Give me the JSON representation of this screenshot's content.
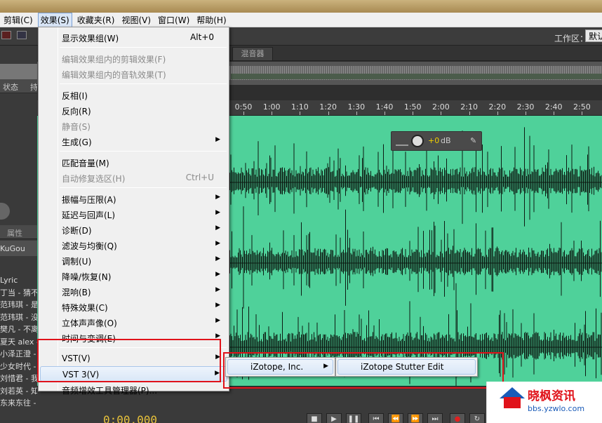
{
  "menubar": {
    "items": [
      "剪辑(C)",
      "效果(S)",
      "收藏夹(R)",
      "视图(V)",
      "窗口(W)",
      "帮助(H)"
    ],
    "active_index": 1
  },
  "toolbar": {
    "workspace_label": "工作区：",
    "workspace_value": "默认"
  },
  "left_panel": {
    "status_label": "状态",
    "col2_label": "持",
    "props_tab": "属性",
    "kugou_label": "KuGou",
    "files": [
      "Lyric",
      "丁当 - 猜不",
      "范玮琪 - 是",
      "范玮琪 - 没",
      "樊凡 - 不离",
      "夏天 alex -",
      "小泽正澄 -",
      "少女时代 -",
      "刘惜君 - 我",
      "刘若英 - 知道不知道 .mp",
      "东来东往 - ... 婚娅插曲】"
    ]
  },
  "editor": {
    "mixer_tab": "混音器",
    "ruler_ticks": [
      "0:50",
      "1:00",
      "1:10",
      "1:20",
      "1:30",
      "1:40",
      "1:50",
      "2:00",
      "2:10",
      "2:20",
      "2:30",
      "2:40",
      "2:50"
    ],
    "hud": {
      "value": "+0",
      "unit": "dB"
    },
    "waveform_color": "#4fd19a"
  },
  "transport": {
    "timecode": "0:00.000"
  },
  "effects_menu": {
    "items": [
      {
        "label": "显示效果组(W)",
        "shortcut": "Alt+0",
        "disabled": false,
        "submenu": false
      },
      {
        "sep": true
      },
      {
        "label": "编辑效果组内的剪辑效果(F)",
        "shortcut": "",
        "disabled": true,
        "submenu": false
      },
      {
        "label": "编辑效果组内的音轨效果(T)",
        "shortcut": "",
        "disabled": true,
        "submenu": false
      },
      {
        "sep": true
      },
      {
        "label": "反相(I)",
        "shortcut": "",
        "disabled": false,
        "submenu": false
      },
      {
        "label": "反向(R)",
        "shortcut": "",
        "disabled": false,
        "submenu": false
      },
      {
        "label": "静音(S)",
        "shortcut": "",
        "disabled": true,
        "submenu": false
      },
      {
        "label": "生成(G)",
        "shortcut": "",
        "disabled": false,
        "submenu": true
      },
      {
        "sep": true
      },
      {
        "label": "匹配音量(M)",
        "shortcut": "",
        "disabled": false,
        "submenu": false
      },
      {
        "label": "自动修复选区(H)",
        "shortcut": "Ctrl+U",
        "disabled": true,
        "submenu": false
      },
      {
        "sep": true
      },
      {
        "label": "振幅与压限(A)",
        "shortcut": "",
        "disabled": false,
        "submenu": true
      },
      {
        "label": "延迟与回声(L)",
        "shortcut": "",
        "disabled": false,
        "submenu": true
      },
      {
        "label": "诊断(D)",
        "shortcut": "",
        "disabled": false,
        "submenu": true
      },
      {
        "label": "滤波与均衡(Q)",
        "shortcut": "",
        "disabled": false,
        "submenu": true
      },
      {
        "label": "调制(U)",
        "shortcut": "",
        "disabled": false,
        "submenu": true
      },
      {
        "label": "降噪/恢复(N)",
        "shortcut": "",
        "disabled": false,
        "submenu": true
      },
      {
        "label": "混响(B)",
        "shortcut": "",
        "disabled": false,
        "submenu": true
      },
      {
        "label": "特殊效果(C)",
        "shortcut": "",
        "disabled": false,
        "submenu": true
      },
      {
        "label": "立体声声像(O)",
        "shortcut": "",
        "disabled": false,
        "submenu": true
      },
      {
        "label": "时间与变调(E)",
        "shortcut": "",
        "disabled": false,
        "submenu": true
      },
      {
        "sep": true
      },
      {
        "label": "VST(V)",
        "shortcut": "",
        "disabled": false,
        "submenu": true
      },
      {
        "label": "VST 3(V)",
        "shortcut": "",
        "disabled": false,
        "submenu": true,
        "highlighted": true
      },
      {
        "label": "音频增效工具管理器(P)...",
        "shortcut": "",
        "disabled": false,
        "submenu": false
      }
    ]
  },
  "submenu_vst3": {
    "label": "iZotope, Inc."
  },
  "submenu_izotope": {
    "label": "iZotope Stutter Edit"
  },
  "watermark": {
    "title": "晓枫资讯",
    "url": "bbs.yzwlo.com"
  },
  "colors": {
    "annotation_red": "#e0121a",
    "menu_highlight": "#dae7f7"
  }
}
